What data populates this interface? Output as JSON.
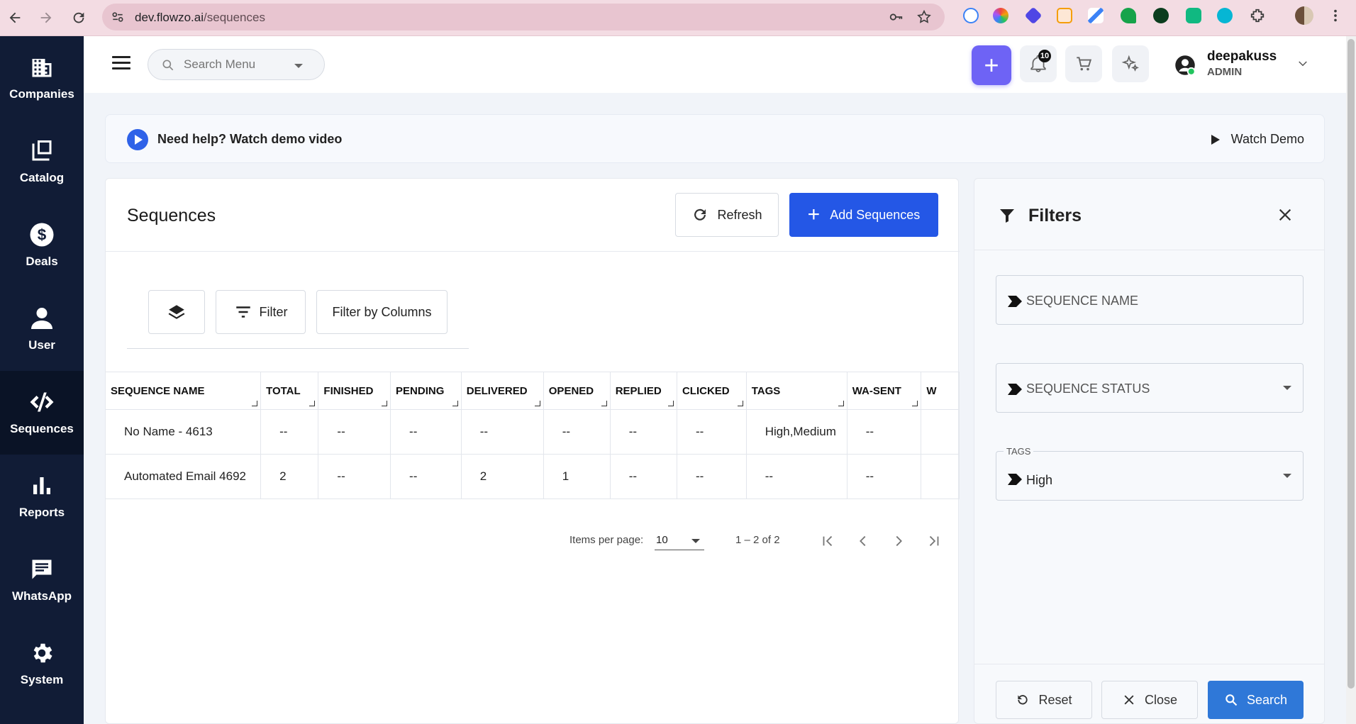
{
  "browser": {
    "url_host": "dev.flowzo.ai",
    "url_path": "/sequences"
  },
  "sidebar": {
    "items": [
      {
        "label": "Companies",
        "icon": "building-icon"
      },
      {
        "label": "Catalog",
        "icon": "catalog-icon"
      },
      {
        "label": "Deals",
        "icon": "dollar-icon"
      },
      {
        "label": "User",
        "icon": "person-icon"
      },
      {
        "label": "Sequences",
        "icon": "code-icon",
        "active": true
      },
      {
        "label": "Reports",
        "icon": "bar-chart-icon"
      },
      {
        "label": "WhatsApp",
        "icon": "chat-icon"
      },
      {
        "label": "System",
        "icon": "gear-icon"
      }
    ]
  },
  "topbar": {
    "search_placeholder": "Search Menu",
    "notifications_count": "10",
    "user_name": "deepakuss",
    "user_role": "ADMIN"
  },
  "help": {
    "text": "Need help? Watch demo video",
    "watch_label": "Watch Demo"
  },
  "main": {
    "title": "Sequences",
    "refresh_label": "Refresh",
    "add_label": "Add Sequences",
    "filter_label": "Filter",
    "filter_columns_label": "Filter by Columns",
    "columns": [
      "SEQUENCE NAME",
      "TOTAL",
      "FINISHED",
      "PENDING",
      "DELIVERED",
      "OPENED",
      "REPLIED",
      "CLICKED",
      "TAGS",
      "WA-SENT",
      "W"
    ],
    "rows": [
      [
        "No Name - 4613",
        "--",
        "--",
        "--",
        "--",
        "--",
        "--",
        "--",
        "High,Medium",
        "--",
        ""
      ],
      [
        "Automated Email 4692",
        "2",
        "--",
        "--",
        "2",
        "1",
        "--",
        "--",
        "--",
        "--",
        ""
      ]
    ],
    "pager": {
      "items_per_page_label": "Items per page:",
      "items_per_page": "10",
      "range": "1 – 2 of 2"
    }
  },
  "filters": {
    "title": "Filters",
    "sequence_name_placeholder": "SEQUENCE NAME",
    "sequence_status_placeholder": "SEQUENCE STATUS",
    "tags_label": "TAGS",
    "tags_value": "High",
    "reset_label": "Reset",
    "close_label": "Close",
    "search_label": "Search"
  },
  "colors": {
    "sidebar_bg": "#111c36",
    "primary": "#2457e6",
    "accent_plus": "#6e63f5",
    "search_btn": "#2f78d8"
  }
}
